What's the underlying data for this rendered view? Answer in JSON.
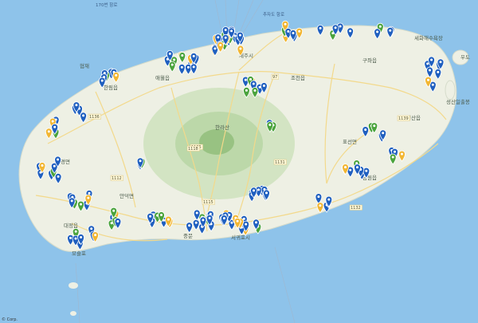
{
  "map": {
    "credit": "© Corp.",
    "colors": {
      "sea": "#8ec3ea",
      "land": "#eef0e4",
      "mountain": "#b9d6a6",
      "peak": "#93c07d",
      "road": "#f3d98b",
      "pin_blue": "#1f5fbf",
      "pin_green": "#4aa33c",
      "pin_yellow": "#f2b632"
    },
    "sea_labels": [
      "170번 항로",
      "추자도 항로"
    ],
    "place_labels": [
      {
        "text": "한림읍"
      },
      {
        "text": "애월읍"
      },
      {
        "text": "제주시"
      },
      {
        "text": "조천읍"
      },
      {
        "text": "구좌읍"
      },
      {
        "text": "한경면"
      },
      {
        "text": "안덕면"
      },
      {
        "text": "대정읍"
      },
      {
        "text": "서귀포시"
      },
      {
        "text": "남원읍"
      },
      {
        "text": "표선면"
      },
      {
        "text": "성산읍"
      },
      {
        "text": "한라산"
      },
      {
        "text": "세화해수욕장"
      },
      {
        "text": "우도"
      },
      {
        "text": "성산일출봉"
      },
      {
        "text": "협재"
      },
      {
        "text": "중문"
      },
      {
        "text": "화순"
      },
      {
        "text": "모슬포"
      }
    ],
    "road_labels": [
      "1136",
      "1135",
      "1139",
      "1131",
      "1132",
      "1118",
      "1112",
      "1115",
      "97"
    ]
  }
}
